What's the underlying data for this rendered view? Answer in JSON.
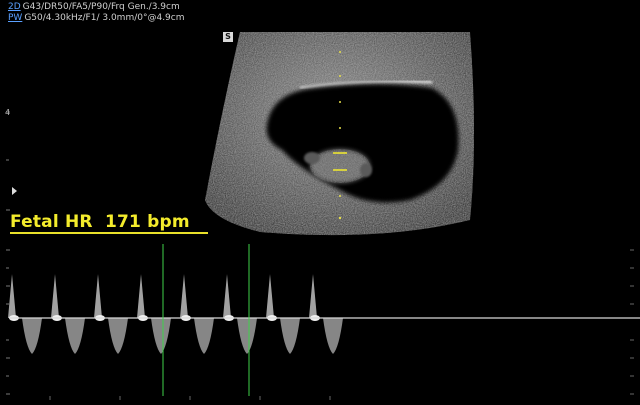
{
  "header": {
    "line1_mode": "2D",
    "line1_params": "G43/DR50/FA5/P90/Frq Gen./3.9cm",
    "line2_mode": "PW",
    "line2_params": "G50/4.30kHz/F1/ 3.0mm/0°@4.9cm"
  },
  "sector_marker": "S",
  "depth_tick_label": "4",
  "fetal_hr": {
    "label": "Fetal HR  171 bpm",
    "color": "#f4ec2c"
  },
  "colors": {
    "background": "#000000",
    "annotation_yellow": "#f4ec2c",
    "cursor_green": "#3fd24a",
    "mode_blue": "#5aa0ff"
  },
  "icons": [
    "depth-pointer-icon"
  ]
}
